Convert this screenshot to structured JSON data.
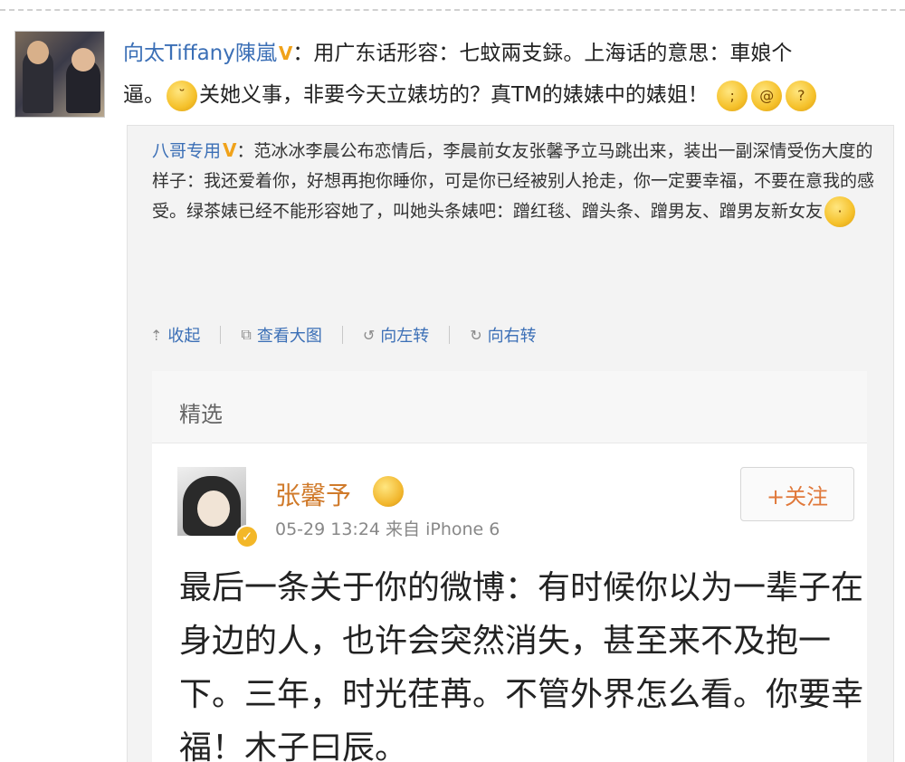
{
  "main_post": {
    "author": "向太Tiffany陳嵐",
    "badge": "V",
    "text_1": "：用广东话形容：七蚊兩支銾。上海话的意思：車娘个",
    "text_2a": "逼。",
    "text_2b": "关她义事，非要今天立婊坊的？真TM的婊婊中的婊姐！"
  },
  "repost": {
    "author": "八哥专用",
    "badge": "V",
    "text": "：范冰冰李晨公布恋情后，李晨前女友张馨予立马跳出来，装出一副深情受伤大度的样子：我还爱着你，好想再抱你睡你，可是你已经被别人抢走，你一定要幸福，不要在意我的感受。绿茶婊已经不能形容她了，叫她头条婊吧：蹭红毯、蹭头条、蹭男友、蹭男友新女友"
  },
  "actions": {
    "collapse": "收起",
    "view_large": "查看大图",
    "rotate_left": "向左转",
    "rotate_right": "向右转"
  },
  "card": {
    "section_label": "精选",
    "name": "张馨予",
    "meta": "05-29 13:24  来自 iPhone 6",
    "follow": "+关注",
    "body": "最后一条关于你的微博：有时候你以为一辈子在身边的人，也许会突然消失，甚至来不及抱一下。三年，时光荏苒。不管外界怎么看。你要幸福！木子曰辰。"
  }
}
